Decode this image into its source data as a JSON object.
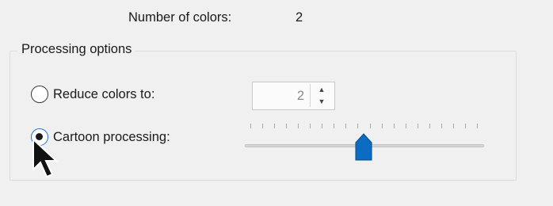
{
  "summary": {
    "label": "Number of colors:",
    "value": "2"
  },
  "processing_options": {
    "title": "Processing options",
    "reduce_colors": {
      "label": "Reduce colors to:",
      "selected": false,
      "spinner_value": "2"
    },
    "cartoon_processing": {
      "label": "Cartoon processing:",
      "selected": true,
      "slider_level_fraction": 0.5
    }
  },
  "colors": {
    "accent": "#1e73c9",
    "thumb": "#0a6dc2"
  }
}
